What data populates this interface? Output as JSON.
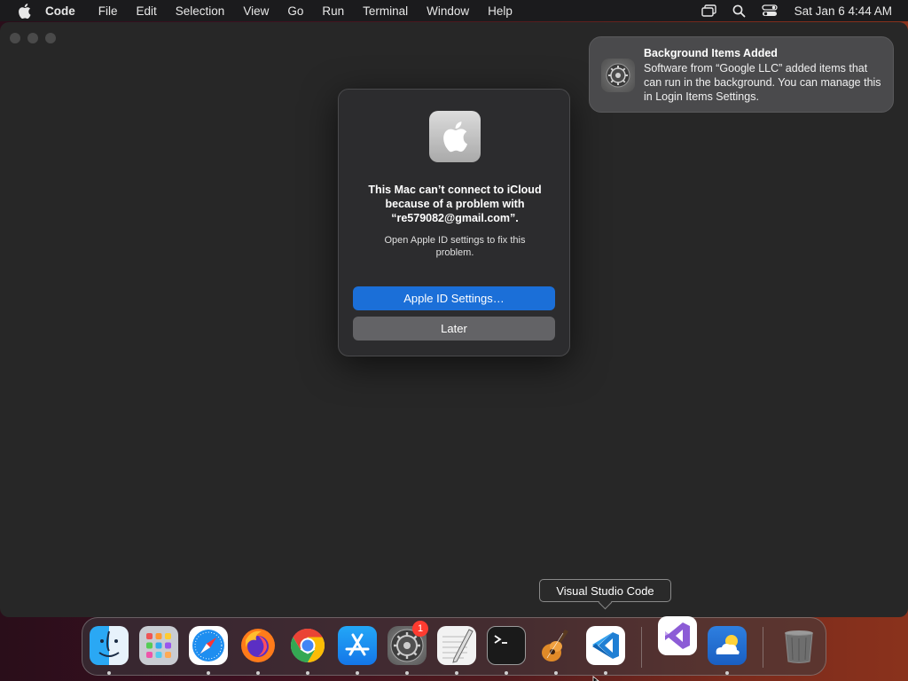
{
  "menubar": {
    "app_name": "Code",
    "items": [
      "File",
      "Edit",
      "Selection",
      "View",
      "Go",
      "Run",
      "Terminal",
      "Window",
      "Help"
    ],
    "clock": "Sat Jan 6  4:44 AM",
    "icons": [
      "apple-icon",
      "screen-mirroring-icon",
      "spotlight-search-icon",
      "control-center-icon"
    ]
  },
  "dialog": {
    "title": "This Mac can’t connect to iCloud because of a problem with “re579082@gmail.com”.",
    "message": "Open Apple ID settings to fix this problem.",
    "primary_button": "Apple ID Settings…",
    "secondary_button": "Later",
    "icon": "apple-logo-icon"
  },
  "notification": {
    "title": "Background Items Added",
    "body": "Software from “Google LLC” added items that can run in the background. You can manage this in Login Items Settings.",
    "icon": "system-settings-gear-icon"
  },
  "tooltip": {
    "label": "Visual Studio Code"
  },
  "dock": {
    "apps": [
      {
        "name": "Finder",
        "icon": "finder-icon",
        "running": true
      },
      {
        "name": "Launchpad",
        "icon": "launchpad-icon",
        "running": false
      },
      {
        "name": "Safari",
        "icon": "safari-icon",
        "running": true
      },
      {
        "name": "Firefox",
        "icon": "firefox-icon",
        "running": true
      },
      {
        "name": "Google Chrome",
        "icon": "chrome-icon",
        "running": true
      },
      {
        "name": "App Store",
        "icon": "app-store-icon",
        "running": true
      },
      {
        "name": "System Settings",
        "icon": "system-settings-icon",
        "running": true,
        "badge": "1"
      },
      {
        "name": "TextEdit",
        "icon": "textedit-icon",
        "running": true
      },
      {
        "name": "Terminal",
        "icon": "terminal-icon",
        "running": true
      },
      {
        "name": "GarageBand",
        "icon": "garageband-icon",
        "running": true
      },
      {
        "name": "Visual Studio Code",
        "icon": "vscode-icon",
        "running": true
      },
      {
        "name": "Visual Studio",
        "icon": "visual-studio-icon",
        "running": false
      },
      {
        "name": "Weather",
        "icon": "weather-icon",
        "running": true
      },
      {
        "name": "Trash",
        "icon": "trash-icon",
        "running": false
      }
    ],
    "badge_count": "1"
  },
  "colors": {
    "accent_blue": "#1b6fd8",
    "badge_red": "#ff3b30",
    "menubar_bg": "#1b1b1d",
    "window_bg": "#272727"
  }
}
